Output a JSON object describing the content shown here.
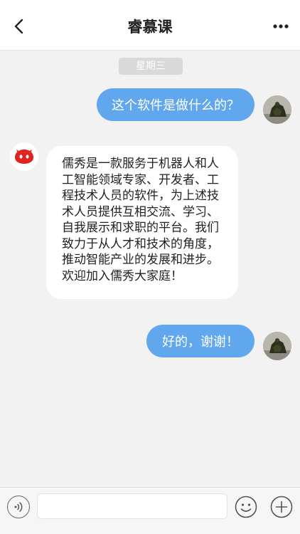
{
  "header": {
    "title": "睿慕课",
    "back_icon": "chevron-left-icon",
    "more_icon": "more-horizontal-icon"
  },
  "chat": {
    "day_label": "星期三",
    "messages": [
      {
        "sender": "user",
        "text": "这个软件是做什么的？"
      },
      {
        "sender": "bot",
        "text": "儒秀是一款服务于机器人和人工智能领域专家、开发者、工程技术人员的软件，为上述技术人员提供互相交流、学习、自我展示和求职的平台。我们致力于从人才和技术的角度，推动智能产业的发展和进步。欢迎加入儒秀大家庭！"
      },
      {
        "sender": "user",
        "text": "好的，谢谢！"
      }
    ]
  },
  "input_bar": {
    "voice_icon": "voice-icon",
    "input_value": "",
    "emoji_icon": "emoji-icon",
    "plus_icon": "plus-icon"
  },
  "colors": {
    "outgoing_bubble": "#61a7ee",
    "incoming_bubble": "#ffffff",
    "background": "#f2f2f2",
    "bot_avatar": "#e0241f"
  }
}
